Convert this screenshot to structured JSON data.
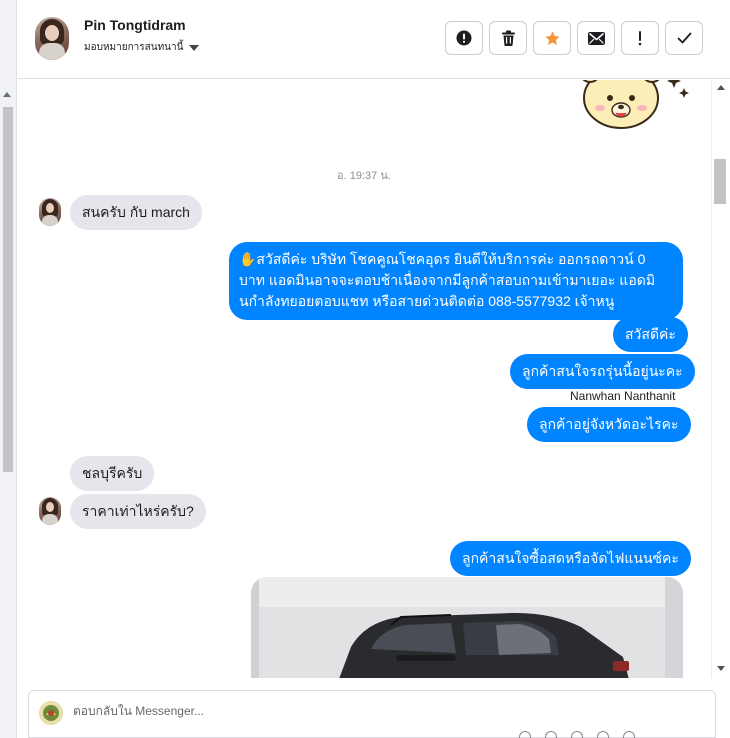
{
  "header": {
    "contact_name": "Pin Tongtidram",
    "assign_label": "มอบหมายการสนทนานี้",
    "actions": [
      {
        "name": "mark-spam-button",
        "icon": "alert-circle-icon"
      },
      {
        "name": "delete-button",
        "icon": "trash-icon"
      },
      {
        "name": "star-button",
        "icon": "star-icon"
      },
      {
        "name": "mark-unread-button",
        "icon": "envelope-icon"
      },
      {
        "name": "follow-up-button",
        "icon": "exclamation-icon"
      },
      {
        "name": "mark-done-button",
        "icon": "check-icon"
      }
    ]
  },
  "chat": {
    "timestamp": "อ. 19:37 น.",
    "messages": [
      {
        "id": "m1",
        "direction": "in",
        "text": "สนครับ กับ march"
      },
      {
        "id": "m2",
        "direction": "out",
        "text": "✋สวัสดีค่ะ บริษัท โชคคูณโชคอุดร ยินดีให้บริการค่ะ ออกรถดาวน์ 0 บาท แอดมินอาจจะตอบช้าเนื่องจากมีลูกค้าสอบถามเข้ามาเยอะ แอดมินกำลังทยอยตอบแชท หรือสายด่วนติดต่อ 088-5577932 เจ้าหนู"
      },
      {
        "id": "m3",
        "direction": "out",
        "text": "สวัสดีค่ะ"
      },
      {
        "id": "m4",
        "direction": "out",
        "text": "ลูกค้าสนใจรถรุ่นนี้อยู่นะคะ"
      },
      {
        "id": "m5",
        "direction": "out",
        "text": "ลูกค้าอยู่จังหวัดอะไรคะ"
      },
      {
        "id": "m6",
        "direction": "in",
        "text": "ชลบุรีครับ"
      },
      {
        "id": "m7",
        "direction": "in",
        "text": "ราคาเท่าไหร่ครับ?"
      },
      {
        "id": "m8",
        "direction": "out",
        "text": "ลูกค้าสนใจซื้อสดหรือจัดไฟแนนซ์คะ"
      }
    ],
    "sender_label": "Nanwhan Nanthanit"
  },
  "composer": {
    "placeholder": "ตอบกลับใน Messenger..."
  },
  "colors": {
    "outgoing_bubble": "#0084ff",
    "incoming_bubble": "#e4e6eb",
    "star_active": "#f7923a"
  }
}
